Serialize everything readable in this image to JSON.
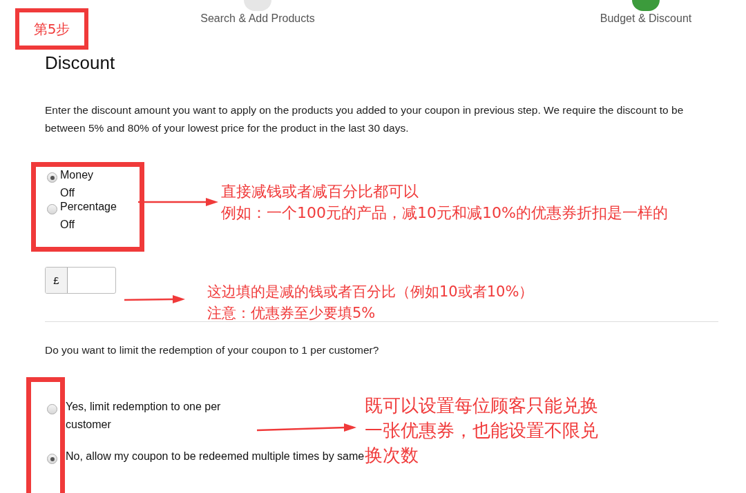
{
  "stepper": {
    "steps": [
      {
        "label": "Search & Add Products",
        "completed": false
      },
      {
        "label": "Budget & Discount",
        "completed": true
      }
    ]
  },
  "discount": {
    "heading": "Discount",
    "description": "Enter the discount amount you want to apply on the products you added to your coupon in previous step. We require the discount to be between 5% and 80% of your lowest price for the product in the last 30 days.",
    "types": [
      {
        "label": "Money Off",
        "selected": true
      },
      {
        "label": "Percentage Off",
        "selected": false
      }
    ],
    "amount": {
      "currency": "£"
    }
  },
  "limit": {
    "question": "Do you want to limit the redemption of your coupon to 1 per customer?",
    "options": [
      {
        "label": "Yes, limit redemption to one per customer",
        "selected": false
      },
      {
        "label": "No, allow my coupon to be redeemed multiple times by same",
        "selected": true
      }
    ]
  },
  "annotations": [
    {
      "kind": "tag",
      "lines": [
        "第5步"
      ]
    },
    {
      "kind": "note",
      "lines": [
        "直接减钱或者减百分比都可以",
        "例如：一个100元的产品，减10元和减10%的优惠券折扣是一样的"
      ]
    },
    {
      "kind": "note",
      "lines": [
        "这边填的是减的钱或者百分比（例如10或者10%）",
        "注意：优惠券至少要填5%"
      ]
    },
    {
      "kind": "note",
      "lines": [
        "既可以设置每位顾客只能兑换",
        "一张优惠券，也能设置不限兑",
        "换次数"
      ]
    }
  ]
}
